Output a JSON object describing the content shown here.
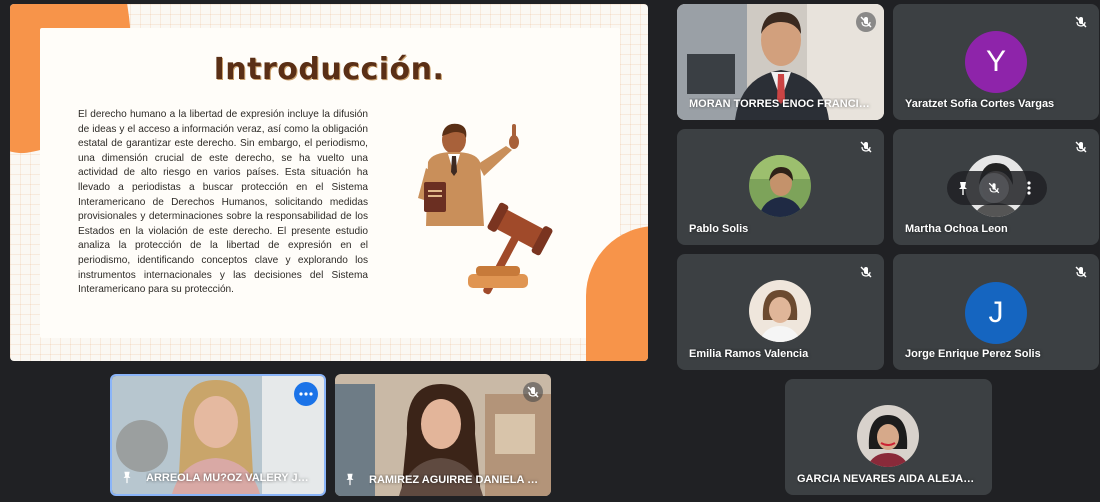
{
  "slide": {
    "title": "Introducción.",
    "body": "El derecho humano a la libertad de expresión incluye la difusión de ideas y el acceso a información veraz, así como la obligación estatal de garantizar este derecho. Sin embargo, el periodismo, una dimensión crucial de este derecho, se ha vuelto una actividad de alto riesgo en varios países. Esta situación ha llevado a periodistas a buscar protección en el Sistema Interamericano de Derechos Humanos, solicitando medidas provisionales y determinaciones sobre la responsabilidad de los Estados en la violación de este derecho. El presente estudio analiza la protección de la libertad de expresión en el periodismo, identificando conceptos clave y explorando los instrumentos internacionales y las decisiones del Sistema Interamericano para su protección.",
    "accent_color": "#f7944a"
  },
  "participants": {
    "moran": {
      "name": "MORAN TORRES ENOC FRANCISCO",
      "muted": true
    },
    "yaratzet": {
      "name": "Yaratzet Sofia Cortes Vargas",
      "initial": "Y",
      "avatar_color": "#8e24aa",
      "muted": true
    },
    "pablo": {
      "name": "Pablo Solis",
      "muted": true
    },
    "martha": {
      "name": "Martha Ochoa Leon",
      "muted": true
    },
    "emilia": {
      "name": "Emilia Ramos Valencia",
      "muted": true
    },
    "jorge": {
      "name": "Jorge Enrique Perez Solis",
      "initial": "J",
      "avatar_color": "#1565c0",
      "muted": true
    },
    "garcia": {
      "name": "GARCIA NEVARES AIDA ALEJAND...",
      "muted": false
    },
    "arreola": {
      "name": "ARREOLA MU?OZ VALERY JOH...",
      "pinned": true,
      "active_speaker": true
    },
    "ramirez": {
      "name": "RAMIREZ AGUIRRE DANIELA BE...",
      "pinned": true,
      "muted": true
    }
  },
  "hover_toolbar": {
    "pin_icon": "pin-icon",
    "mute_icon": "mic-off-icon",
    "more_icon": "more-vert-icon"
  },
  "colors": {
    "tile_bg": "#3c4043",
    "page_bg": "#202124",
    "active_border": "#8ab4f8"
  }
}
